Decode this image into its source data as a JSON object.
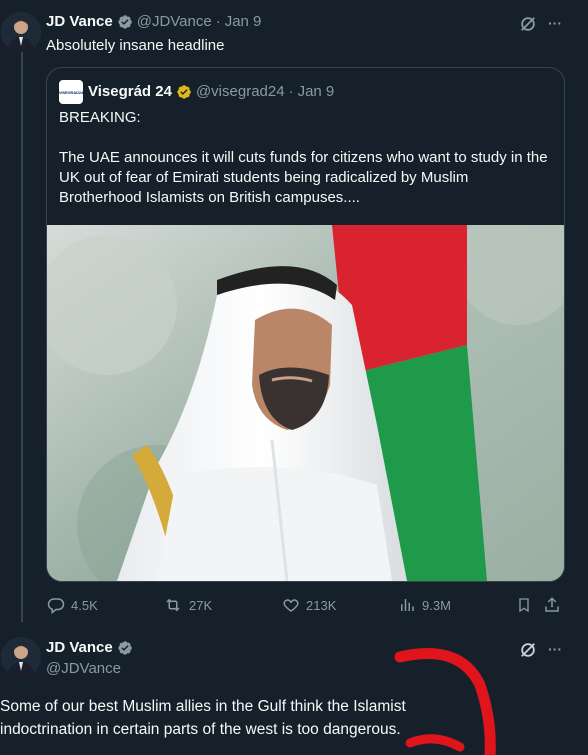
{
  "tweet1": {
    "author_name": "JD Vance",
    "handle": "@JDVance",
    "separator": "·",
    "date": "Jan 9",
    "text": "Absolutely insane headline",
    "more_glyph": "···"
  },
  "quote": {
    "logo_text": "VISEGRAD24",
    "author_name": "Visegrád 24",
    "handle": "@visegrad24",
    "separator": "·",
    "date": "Jan 9",
    "line1": "BREAKING:",
    "line2": "The UAE announces it will cuts funds for citizens who want to study in the UK out of fear of Emirati students being radicalized by Muslim Brotherhood Islamists on British campuses...."
  },
  "actions": {
    "replies": "4.5K",
    "reposts": "27K",
    "likes": "213K",
    "views": "9.3M"
  },
  "tweet2": {
    "author_name": "JD Vance",
    "handle": "@JDVance",
    "text": "Some of our best Muslim allies in the Gulf think the Islamist indoctrination in certain parts of the west is too dangerous.",
    "more_glyph": "···"
  },
  "icons": {
    "verified_blue": "#1d9bf0",
    "verified_gold": "#e2b719",
    "grok": "grok-icon",
    "more": "more-icon",
    "reply": "reply-icon",
    "repost": "repost-icon",
    "like": "like-icon",
    "views": "views-icon",
    "bookmark": "bookmark-icon",
    "share": "share-icon"
  }
}
